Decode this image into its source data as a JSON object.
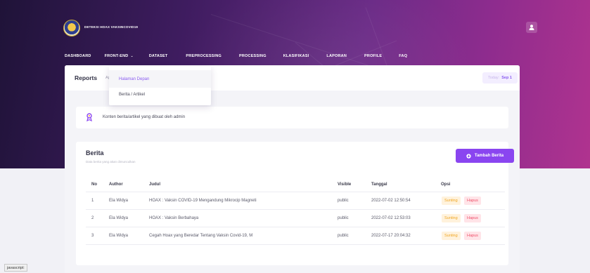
{
  "app": {
    "brand": "DETEKSI HOAX VAKSINCOVID19"
  },
  "nav": {
    "items": [
      {
        "label": "DASHBOARD"
      },
      {
        "label": "FRONT-END"
      },
      {
        "label": "DATASET"
      },
      {
        "label": "PREPROCESSING"
      },
      {
        "label": "PROCESSING"
      },
      {
        "label": "KLASIFIKASI"
      },
      {
        "label": "LAPORAN"
      },
      {
        "label": "PROFILE"
      },
      {
        "label": "FAQ"
      }
    ],
    "dropdown": [
      {
        "label": "Halaman Depan"
      },
      {
        "label": "Berita / Artikel"
      }
    ]
  },
  "reports": {
    "title": "Reports",
    "sub": "Ap",
    "today_label": "Today:",
    "today_value": "Sep 1"
  },
  "info": {
    "text": "Konten berita/artikel yang dibuat oleh admin"
  },
  "table": {
    "title": "Berita",
    "subtitle": "Data berita yang akan dimunculkan",
    "add_button": "Tambah Berita",
    "headers": [
      "No",
      "Author",
      "Judul",
      "Visible",
      "Tanggal",
      "Opsi"
    ],
    "rows": [
      {
        "no": "1",
        "author": "Ela Widya",
        "judul": "HOAX : Vaksin COVID-19 Mengandung Mikrocip Magneti",
        "visible": "public",
        "tanggal": "2022-07-02 12:50:54"
      },
      {
        "no": "2",
        "author": "Ela Widya",
        "judul": "HOAX : Vaksin Berbahaya",
        "visible": "public",
        "tanggal": "2022-07-02 12:53:03"
      },
      {
        "no": "3",
        "author": "Ela Widya",
        "judul": "Cegah Hoax yang Beredar Tentang Vaksin Covid-19, M",
        "visible": "public",
        "tanggal": "2022-07-17 20:04:32"
      }
    ],
    "edit_label": "Sunting",
    "delete_label": "Hapus"
  },
  "statusbar": {
    "text": "javascript:"
  },
  "colors": {
    "accent": "#8a45f0",
    "edit": "#f0a623",
    "delete": "#ef4e68"
  },
  "icons": {
    "user": "user-icon",
    "info": "pin-icon",
    "add": "plus-circle-icon",
    "logo": "emblem-logo"
  }
}
